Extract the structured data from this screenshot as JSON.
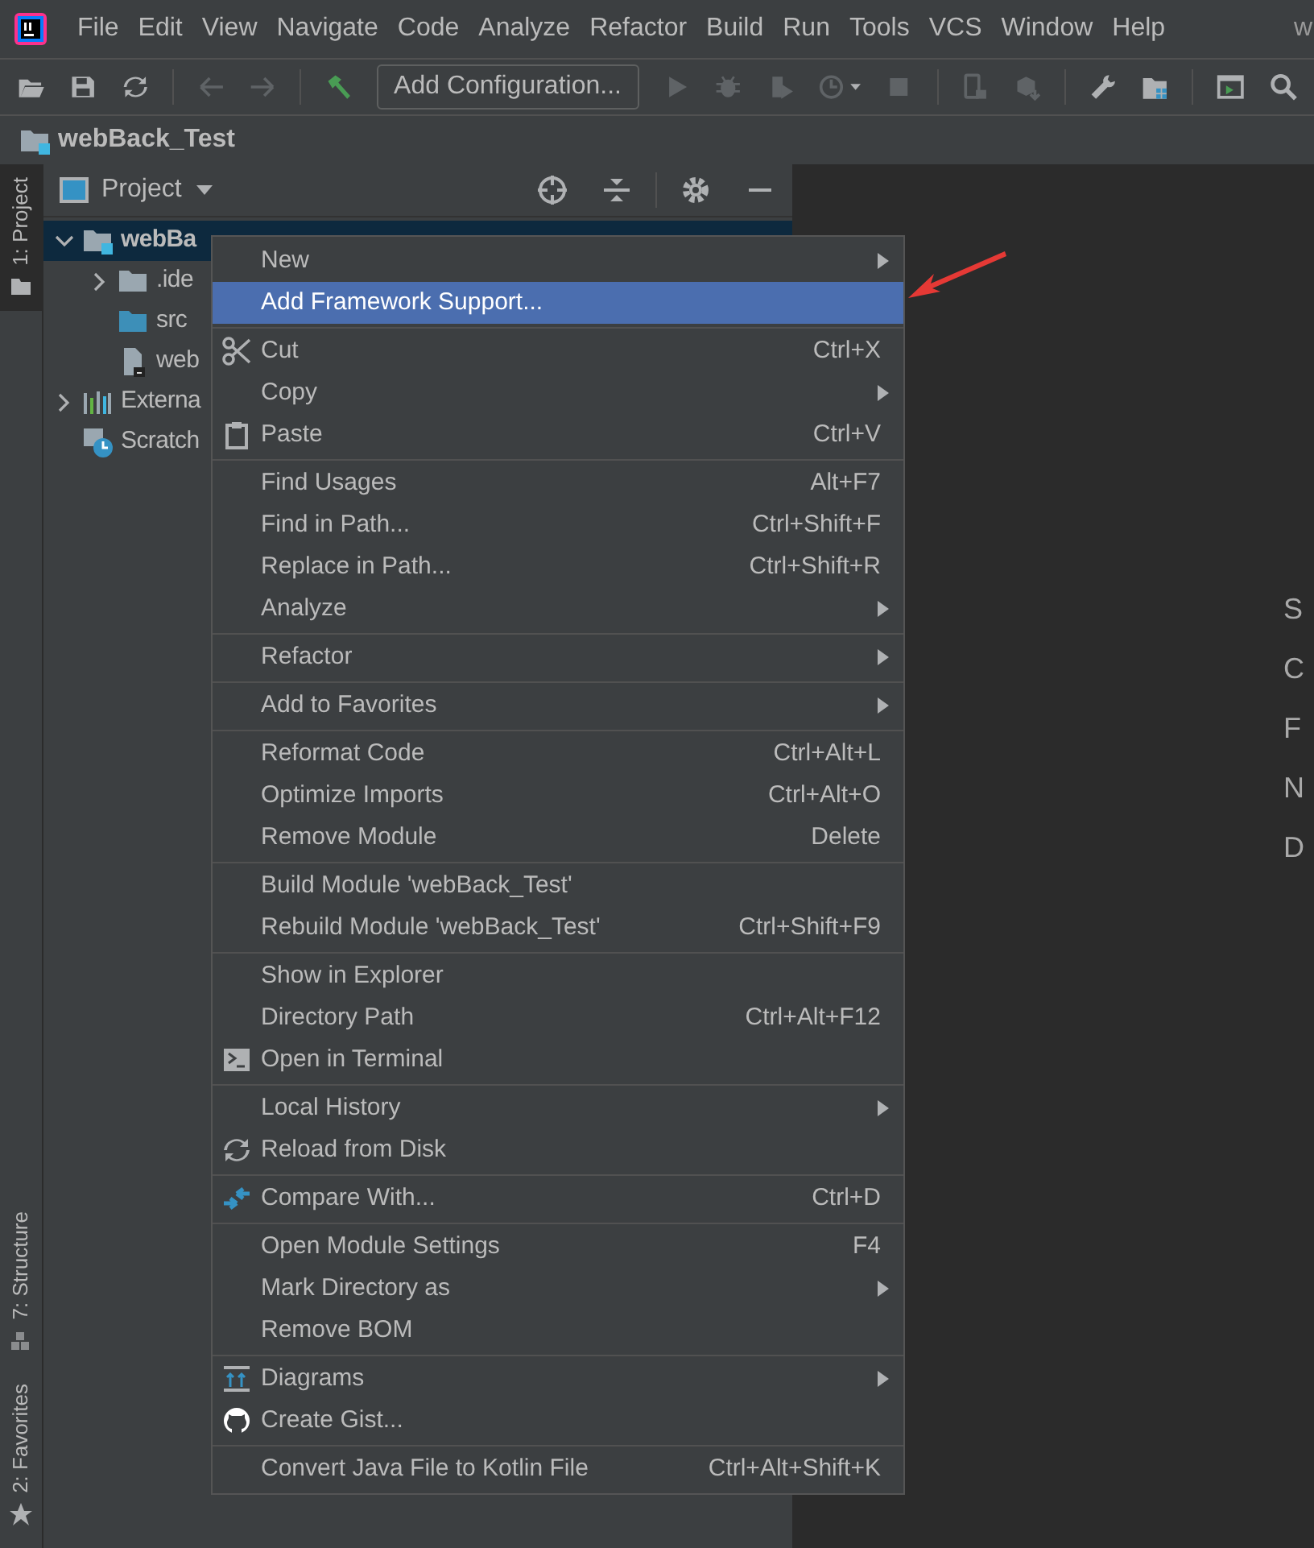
{
  "menu_bar": {
    "items": [
      "File",
      "Edit",
      "View",
      "Navigate",
      "Code",
      "Analyze",
      "Refactor",
      "Build",
      "Run",
      "Tools",
      "VCS",
      "Window",
      "Help"
    ],
    "window_title": "w"
  },
  "toolbar": {
    "configuration": "Add Configuration..."
  },
  "navigation_bar": {
    "project": "webBack_Test"
  },
  "left_strip": {
    "tabs": [
      {
        "label": "1: Project",
        "selected": true
      },
      {
        "label": "7: Structure",
        "selected": false
      },
      {
        "label": "2: Favorites",
        "selected": false
      }
    ]
  },
  "project_panel": {
    "title": "Project",
    "tree": [
      {
        "label": "webBa",
        "kind": "module",
        "expanded": true,
        "selected": true,
        "children": [
          {
            "label": ".ide",
            "kind": "folder",
            "expanded": false,
            "selected": false
          },
          {
            "label": "src",
            "kind": "source",
            "selected": false
          },
          {
            "label": "web",
            "kind": "file",
            "selected": false
          }
        ]
      },
      {
        "label": "Externa",
        "kind": "library",
        "expanded": false,
        "selected": false
      },
      {
        "label": "Scratch",
        "kind": "scratch",
        "selected": false
      }
    ]
  },
  "editor": {
    "hints": [
      "S",
      "C",
      "F",
      "N",
      "D"
    ]
  },
  "context_menu": {
    "groups": [
      {
        "items": [
          {
            "label": "New",
            "submenu": true,
            "selected": false
          },
          {
            "label": "Add Framework Support...",
            "submenu": false,
            "selected": true
          }
        ]
      },
      {
        "items": [
          {
            "label": "Cut",
            "shortcut": "Ctrl+X",
            "kind": "scissors",
            "submenu": false,
            "selected": false
          },
          {
            "label": "Copy",
            "submenu": true,
            "selected": false
          },
          {
            "label": "Paste",
            "shortcut": "Ctrl+V",
            "kind": "clipboard",
            "submenu": false,
            "selected": false
          }
        ]
      },
      {
        "items": [
          {
            "label": "Find Usages",
            "shortcut": "Alt+F7",
            "submenu": false,
            "selected": false
          },
          {
            "label": "Find in Path...",
            "shortcut": "Ctrl+Shift+F",
            "submenu": false,
            "selected": false
          },
          {
            "label": "Replace in Path...",
            "shortcut": "Ctrl+Shift+R",
            "submenu": false,
            "selected": false
          },
          {
            "label": "Analyze",
            "submenu": true,
            "selected": false
          }
        ]
      },
      {
        "items": [
          {
            "label": "Refactor",
            "submenu": true,
            "selected": false
          }
        ]
      },
      {
        "items": [
          {
            "label": "Add to Favorites",
            "submenu": true,
            "selected": false
          }
        ]
      },
      {
        "items": [
          {
            "label": "Reformat Code",
            "shortcut": "Ctrl+Alt+L",
            "submenu": false,
            "selected": false
          },
          {
            "label": "Optimize Imports",
            "shortcut": "Ctrl+Alt+O",
            "submenu": false,
            "selected": false
          },
          {
            "label": "Remove Module",
            "shortcut": "Delete",
            "submenu": false,
            "selected": false
          }
        ]
      },
      {
        "items": [
          {
            "label": "Build Module 'webBack_Test'",
            "submenu": false,
            "selected": false
          },
          {
            "label": "Rebuild Module 'webBack_Test'",
            "shortcut": "Ctrl+Shift+F9",
            "submenu": false,
            "selected": false
          }
        ]
      },
      {
        "items": [
          {
            "label": "Show in Explorer",
            "submenu": false,
            "selected": false
          },
          {
            "label": "Directory Path",
            "shortcut": "Ctrl+Alt+F12",
            "submenu": false,
            "selected": false
          },
          {
            "label": "Open in Terminal",
            "kind": "terminal",
            "submenu": false,
            "selected": false
          }
        ]
      },
      {
        "items": [
          {
            "label": "Local History",
            "submenu": true,
            "selected": false
          },
          {
            "label": "Reload from Disk",
            "kind": "reload",
            "submenu": false,
            "selected": false
          }
        ]
      },
      {
        "items": [
          {
            "label": "Compare With...",
            "shortcut": "Ctrl+D",
            "kind": "compare",
            "submenu": false,
            "selected": false
          }
        ]
      },
      {
        "items": [
          {
            "label": "Open Module Settings",
            "shortcut": "F4",
            "submenu": false,
            "selected": false
          },
          {
            "label": "Mark Directory as",
            "submenu": true,
            "selected": false
          },
          {
            "label": "Remove BOM",
            "submenu": false,
            "selected": false
          }
        ]
      },
      {
        "items": [
          {
            "label": "Diagrams",
            "kind": "diagram",
            "submenu": true,
            "selected": false
          },
          {
            "label": "Create Gist...",
            "kind": "cat",
            "submenu": false,
            "selected": false
          }
        ]
      },
      {
        "items": [
          {
            "label": "Convert Java File to Kotlin File",
            "shortcut": "Ctrl+Alt+Shift+K",
            "submenu": false,
            "selected": false
          }
        ]
      }
    ]
  }
}
